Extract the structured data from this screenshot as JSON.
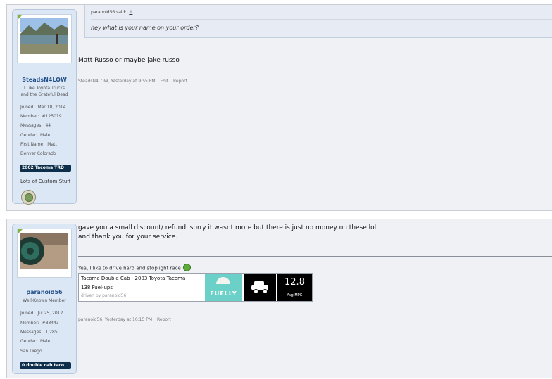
{
  "post1": {
    "user": {
      "name": "SteadsN4LOW",
      "title_line1": "I Like Toyota Trucks",
      "title_line2": "and the Grateful Dead",
      "stats": [
        {
          "label": "Joined:",
          "value": "Mar 10, 2014"
        },
        {
          "label": "Member:",
          "value": "#125019"
        },
        {
          "label": "Messages:",
          "value": "44"
        },
        {
          "label": "Gender:",
          "value": "Male"
        },
        {
          "label": "First Name:",
          "value": "Matt"
        },
        {
          "label": "Denver Colorado",
          "value": ""
        }
      ],
      "badge": "2002 Tacoma TRD",
      "custom": "Lots of Custom Stuff"
    },
    "quote": {
      "author": "paranoid56 said:",
      "arrow": "↑",
      "text": "hey what is your name on your order?"
    },
    "message": "Matt Russo or maybe jake russo",
    "meta": {
      "author": "SteadsN4LOW,",
      "time": "Yesterday at 9:55 PM",
      "edit": "Edit",
      "report": "Report"
    }
  },
  "post2": {
    "user": {
      "name": "paranoid56",
      "title_line1": "Well-Known Member",
      "stats": [
        {
          "label": "Joined:",
          "value": "Jul 25, 2012"
        },
        {
          "label": "Member:",
          "value": "#83443"
        },
        {
          "label": "Messages:",
          "value": "1,285"
        },
        {
          "label": "Gender:",
          "value": "Male"
        },
        {
          "label": "San Diego",
          "value": ""
        }
      ],
      "badge": "0 double cab taco"
    },
    "message_line1": "gave you a small discount/ refund. sorry it wasnt more but there is just no money on these lol.",
    "message_line2": "and thank you for your service.",
    "signature": "Yea, I like to drive hard and stoplight race",
    "fuelly": {
      "title": "Tacoma Double Cab - 2003 Toyota Tacoma",
      "fuelups": "138 Fuel-ups",
      "driven_by": "driven by paranoid56",
      "logo_text": "FUELLY",
      "mpg_value": "12.8",
      "mpg_label": "Avg MPG"
    },
    "meta": {
      "author": "paranoid56,",
      "time": "Yesterday at 10:15 PM",
      "report": "Report"
    }
  },
  "colors": {
    "post_bg": "#f0f1f5",
    "sidebar_bg": "#dce7f5",
    "username": "#24528a",
    "badge_bg": "#0d2f4b",
    "fuelly_teal": "#6ad0c8"
  }
}
